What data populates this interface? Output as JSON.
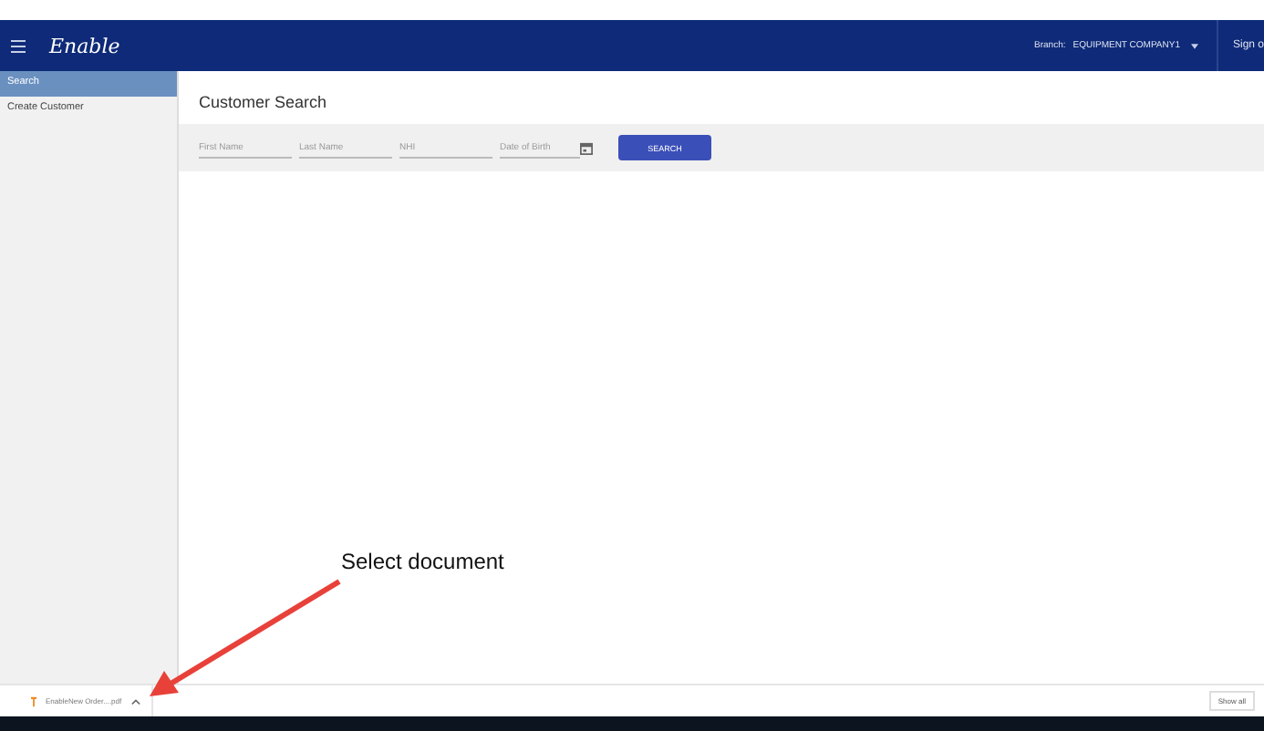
{
  "header": {
    "logo": "Enable",
    "branch_label": "Branch:",
    "branch_value": "EQUIPMENT COMPANY1",
    "sign_out": "Sign o"
  },
  "sidebar": {
    "items": [
      {
        "label": "Search",
        "selected": true
      },
      {
        "label": "Create Customer",
        "selected": false
      }
    ]
  },
  "main": {
    "title": "Customer Search",
    "fields": [
      {
        "placeholder": "First Name",
        "kind": "text"
      },
      {
        "placeholder": "Last Name",
        "kind": "text"
      },
      {
        "placeholder": "NHI",
        "kind": "text"
      },
      {
        "placeholder": "Date of Birth",
        "kind": "date"
      }
    ],
    "search_button": "SEARCH"
  },
  "annotation": {
    "text": "Select document"
  },
  "download_bar": {
    "file": "EnableNew Order....pdf",
    "show_all": "Show all"
  }
}
